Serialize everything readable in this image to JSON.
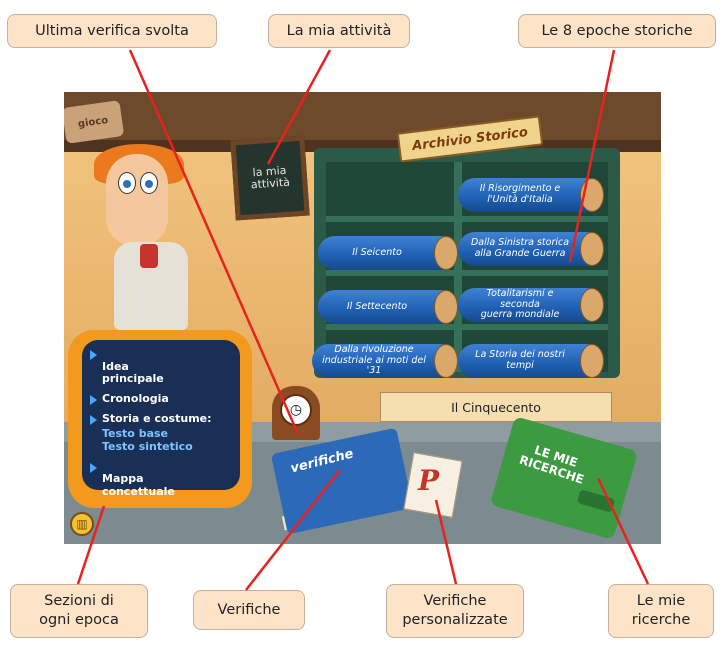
{
  "callouts": {
    "ultima_verifica": "Ultima verifica svolta",
    "mia_attivita": "La mia attività",
    "epoche": "Le 8 epoche storiche",
    "sezioni": "Sezioni di\nogni epoca",
    "verifiche": "Verifiche",
    "personalizzate": "Verifiche\npersonalizzate",
    "ricerche": "Le mie\nricerche"
  },
  "scene": {
    "gioco_sign": "gioco",
    "chalkboard": "la mia\nattività",
    "archive_title": "Archivio Storico",
    "shelves": [
      {
        "label": "Il Risorgimento e\nl'Unità d'Italia"
      },
      {
        "label": "Il Seicento"
      },
      {
        "label": "Dalla Sinistra storica\nalla Grande Guerra"
      },
      {
        "label": "Il Settecento"
      },
      {
        "label": "Totalitarismi e seconda\nguerra mondiale"
      },
      {
        "label": "Dalla rivoluzione\nindustriale ai moti del '31"
      },
      {
        "label": "La Storia dei nostri tempi"
      }
    ],
    "current_epoch": "Il Cinquecento",
    "menu": {
      "idea": "Idea\nprincipale",
      "cronologia": "Cronologia",
      "storia": "Storia e costume:",
      "testo_base": "Testo base",
      "testo_sintetico": "Testo sintetico",
      "mappa": "Mappa\nconcettuale"
    },
    "book_verifiche": "verifiche",
    "papers_letter": "P",
    "book_ricerche": "LE MIE\nRICERCHE"
  },
  "colors": {
    "callout_bg": "#fde3c8",
    "leader_line": "#e8231f",
    "scroll_blue": "#1f5fb2",
    "shelf_green": "#2b5a48",
    "tv_orange": "#f39a1e"
  }
}
